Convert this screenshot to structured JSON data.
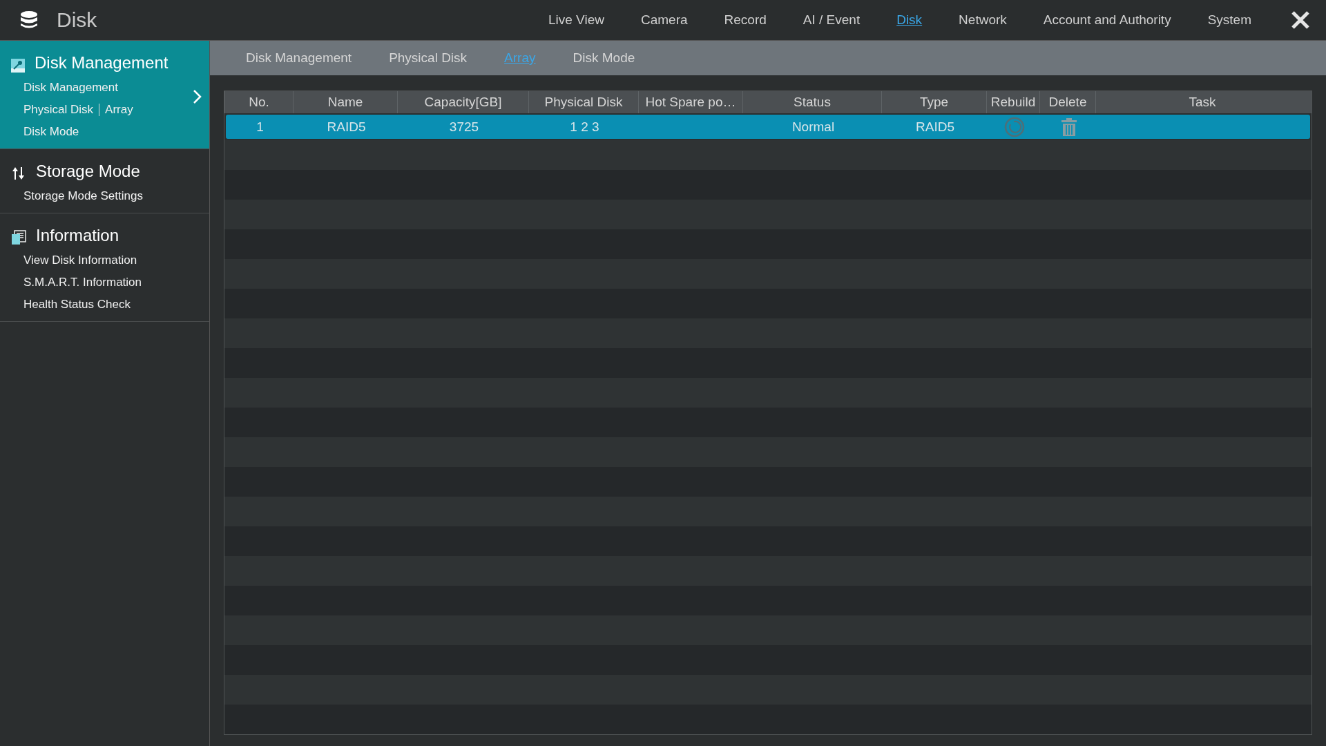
{
  "window": {
    "title": "Disk"
  },
  "top_nav": [
    {
      "label": "Live View",
      "selected": false
    },
    {
      "label": "Camera",
      "selected": false
    },
    {
      "label": "Record",
      "selected": false
    },
    {
      "label": "AI / Event",
      "selected": false
    },
    {
      "label": "Disk",
      "selected": true
    },
    {
      "label": "Network",
      "selected": false
    },
    {
      "label": "Account and Authority",
      "selected": false
    },
    {
      "label": "System",
      "selected": false
    }
  ],
  "sidebar": {
    "groups": [
      {
        "kind": "management",
        "title": "Disk Management",
        "selected": true,
        "lines": [
          [
            "Disk Management"
          ],
          [
            "Physical Disk",
            "Array"
          ],
          [
            "Disk Mode"
          ]
        ]
      },
      {
        "kind": "storage",
        "title": "Storage Mode",
        "selected": false,
        "lines": [
          [
            "Storage Mode Settings"
          ]
        ]
      },
      {
        "kind": "information",
        "title": "Information",
        "selected": false,
        "lines": [
          [
            "View Disk Information"
          ],
          [
            "S.M.A.R.T. Information"
          ],
          [
            "Health Status Check"
          ]
        ]
      }
    ]
  },
  "sub_tabs": [
    {
      "label": "Disk Management",
      "selected": false
    },
    {
      "label": "Physical Disk",
      "selected": false
    },
    {
      "label": "Array",
      "selected": true
    },
    {
      "label": "Disk Mode",
      "selected": false
    }
  ],
  "table": {
    "columns": [
      "No.",
      "Name",
      "Capacity[GB]",
      "Physical Disk",
      "Hot Spare po…",
      "Status",
      "Type",
      "Rebuild",
      "Delete",
      "Task"
    ],
    "rows": [
      {
        "selected": true,
        "no": "1",
        "name": "RAID5",
        "capacity": "3725",
        "physical_disk": "1 2 3",
        "status": "Normal",
        "type": "RAID5"
      }
    ]
  }
}
